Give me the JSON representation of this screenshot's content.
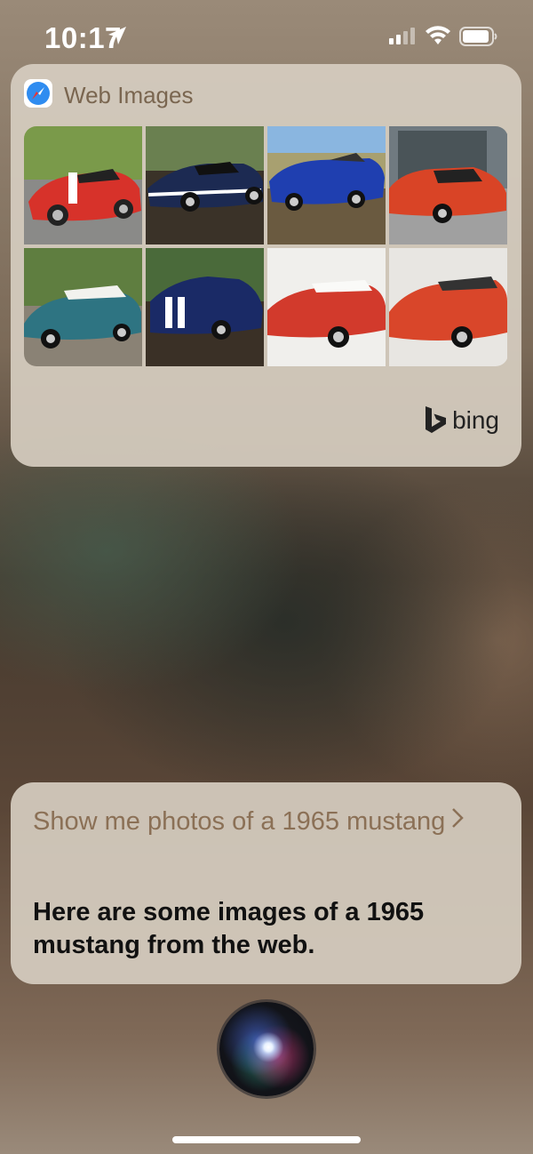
{
  "status": {
    "time": "10:17"
  },
  "images_card": {
    "title": "Web Images",
    "provider": "bing",
    "thumbnails": [
      {
        "label": "red mustang with white stripes"
      },
      {
        "label": "dark blue mustang with white stripes"
      },
      {
        "label": "blue convertible mustang"
      },
      {
        "label": "orange mustang"
      },
      {
        "label": "teal mustang with white roof"
      },
      {
        "label": "blue mustang rear view"
      },
      {
        "label": "red mustang with white roof"
      },
      {
        "label": "red mustang coupe"
      }
    ]
  },
  "dialog": {
    "query": "Show me photos of a 1965 mustang",
    "response": "Here are some images of a 1965 mustang from the web."
  },
  "colors": {
    "query_text": "#8b7056",
    "answer_text": "#111111",
    "card_bg": "#d6cdc0"
  }
}
